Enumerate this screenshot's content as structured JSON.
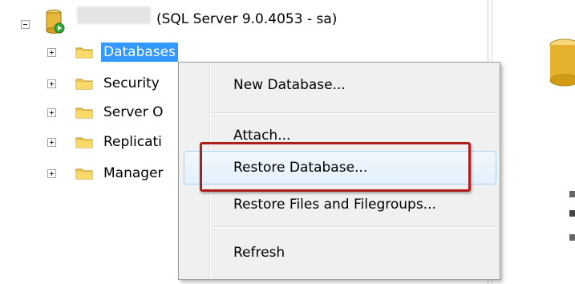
{
  "server": {
    "label": "(SQL Server 9.0.4053 - sa)"
  },
  "tree": [
    {
      "label": "Databases",
      "selected": true
    },
    {
      "label": "Security"
    },
    {
      "label": "Server O"
    },
    {
      "label": "Replicati"
    },
    {
      "label": "Manager"
    }
  ],
  "context_menu": {
    "items": [
      {
        "label": "New Database..."
      },
      {
        "label": "Attach..."
      },
      {
        "label": "Restore Database..."
      },
      {
        "label": "Restore Files and Filegroups..."
      },
      {
        "label": "Refresh"
      }
    ]
  },
  "colors": {
    "selection": "#3399ff",
    "highlight_box": "#b11c1c",
    "menu_bg": "#f0f0f0"
  }
}
